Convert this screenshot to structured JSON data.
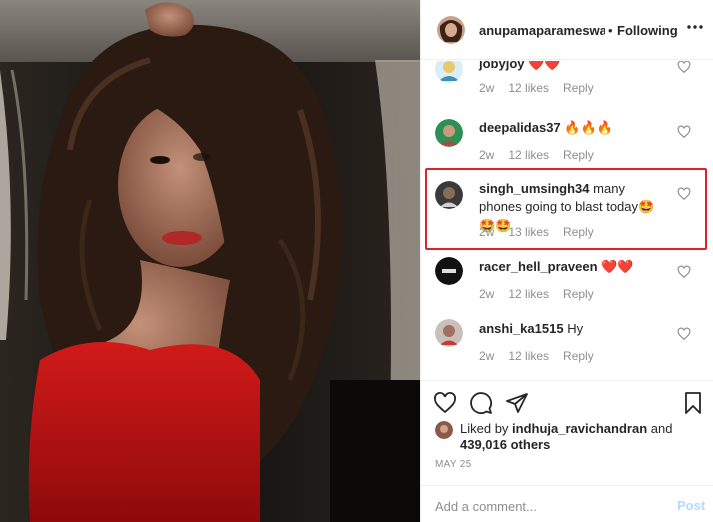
{
  "header": {
    "username": "anupamaparameswaran",
    "separator": "•",
    "follow_status": "Following",
    "more_icon": "more-dots-icon"
  },
  "comments": [
    {
      "username": "jobyjoy",
      "text": "",
      "emoji": "❤️❤️",
      "age": "2w",
      "likes": "12 likes",
      "reply": "Reply"
    },
    {
      "username": "deepalidas37",
      "text": "",
      "emoji": "🔥🔥🔥",
      "age": "2w",
      "likes": "12 likes",
      "reply": "Reply"
    },
    {
      "username": "singh_umsingh34",
      "text": "many phones going to blast today",
      "emoji": "🤩🤩🤩",
      "age": "2w",
      "likes": "13 likes",
      "reply": "Reply"
    },
    {
      "username": "racer_hell_praveen",
      "text": "",
      "emoji": "❤️❤️",
      "age": "2w",
      "likes": "12 likes",
      "reply": "Reply"
    },
    {
      "username": "anshi_ka1515",
      "text": "Hy",
      "emoji": "",
      "age": "2w",
      "likes": "12 likes",
      "reply": "Reply"
    }
  ],
  "liked_by": {
    "prefix": "Liked by",
    "user": "indhuja_ravichandran",
    "conjunction": "and",
    "others": "439,016 others"
  },
  "post_date": "MAY 25",
  "add_comment": {
    "placeholder": "Add a comment...",
    "post_label": "Post"
  },
  "colors": {
    "highlight": "#e0202a",
    "heart_red": "#ed4956",
    "post_disabled": "#b3dbff",
    "muted": "#8e8e8e"
  }
}
